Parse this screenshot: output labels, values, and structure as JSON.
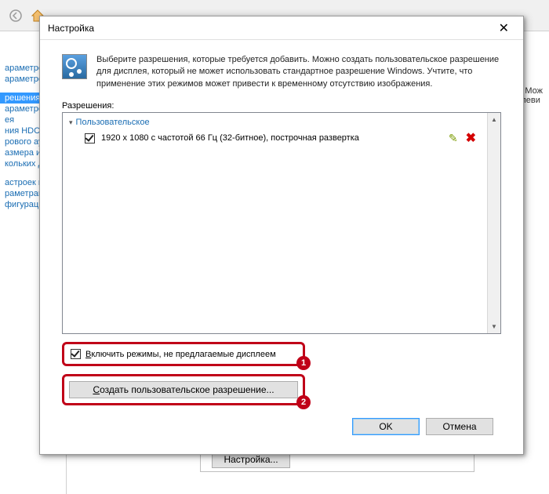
{
  "toolbar": {},
  "bg": {
    "sidebar_items": [
      "араметров",
      "араметров",
      "",
      "решения",
      "араметров",
      "ея",
      "ния HDCP",
      "рового ауд",
      "азмера и п",
      "кольких ди",
      "",
      "астроек из",
      "раметрами",
      "фигурации"
    ],
    "selected_index": 3,
    "right1": "ние. Мож",
    "right2": "телеви",
    "button_label": "Настройка..."
  },
  "dialog": {
    "title": "Настройка",
    "info_text": "Выберите разрешения, которые требуется добавить. Можно создать пользовательское разрешение для дисплея, который не может использовать стандартное разрешение Windows. Учтите, что применение этих режимов может привести к временному отсутствию изображения.",
    "res_label": "Разрешения:",
    "group_header": "Пользовательское",
    "item_text": "1920 x 1080 с частотой 66 Гц (32-битное), построчная развертка",
    "enable_cb_prefix": "В",
    "enable_cb_rest": "ключить режимы, не предлагаемые дисплеем",
    "create_text": "Создать пользовательское разрешение...",
    "ok": "OK",
    "cancel": "Отмена",
    "marker1": "1",
    "marker2": "2"
  }
}
